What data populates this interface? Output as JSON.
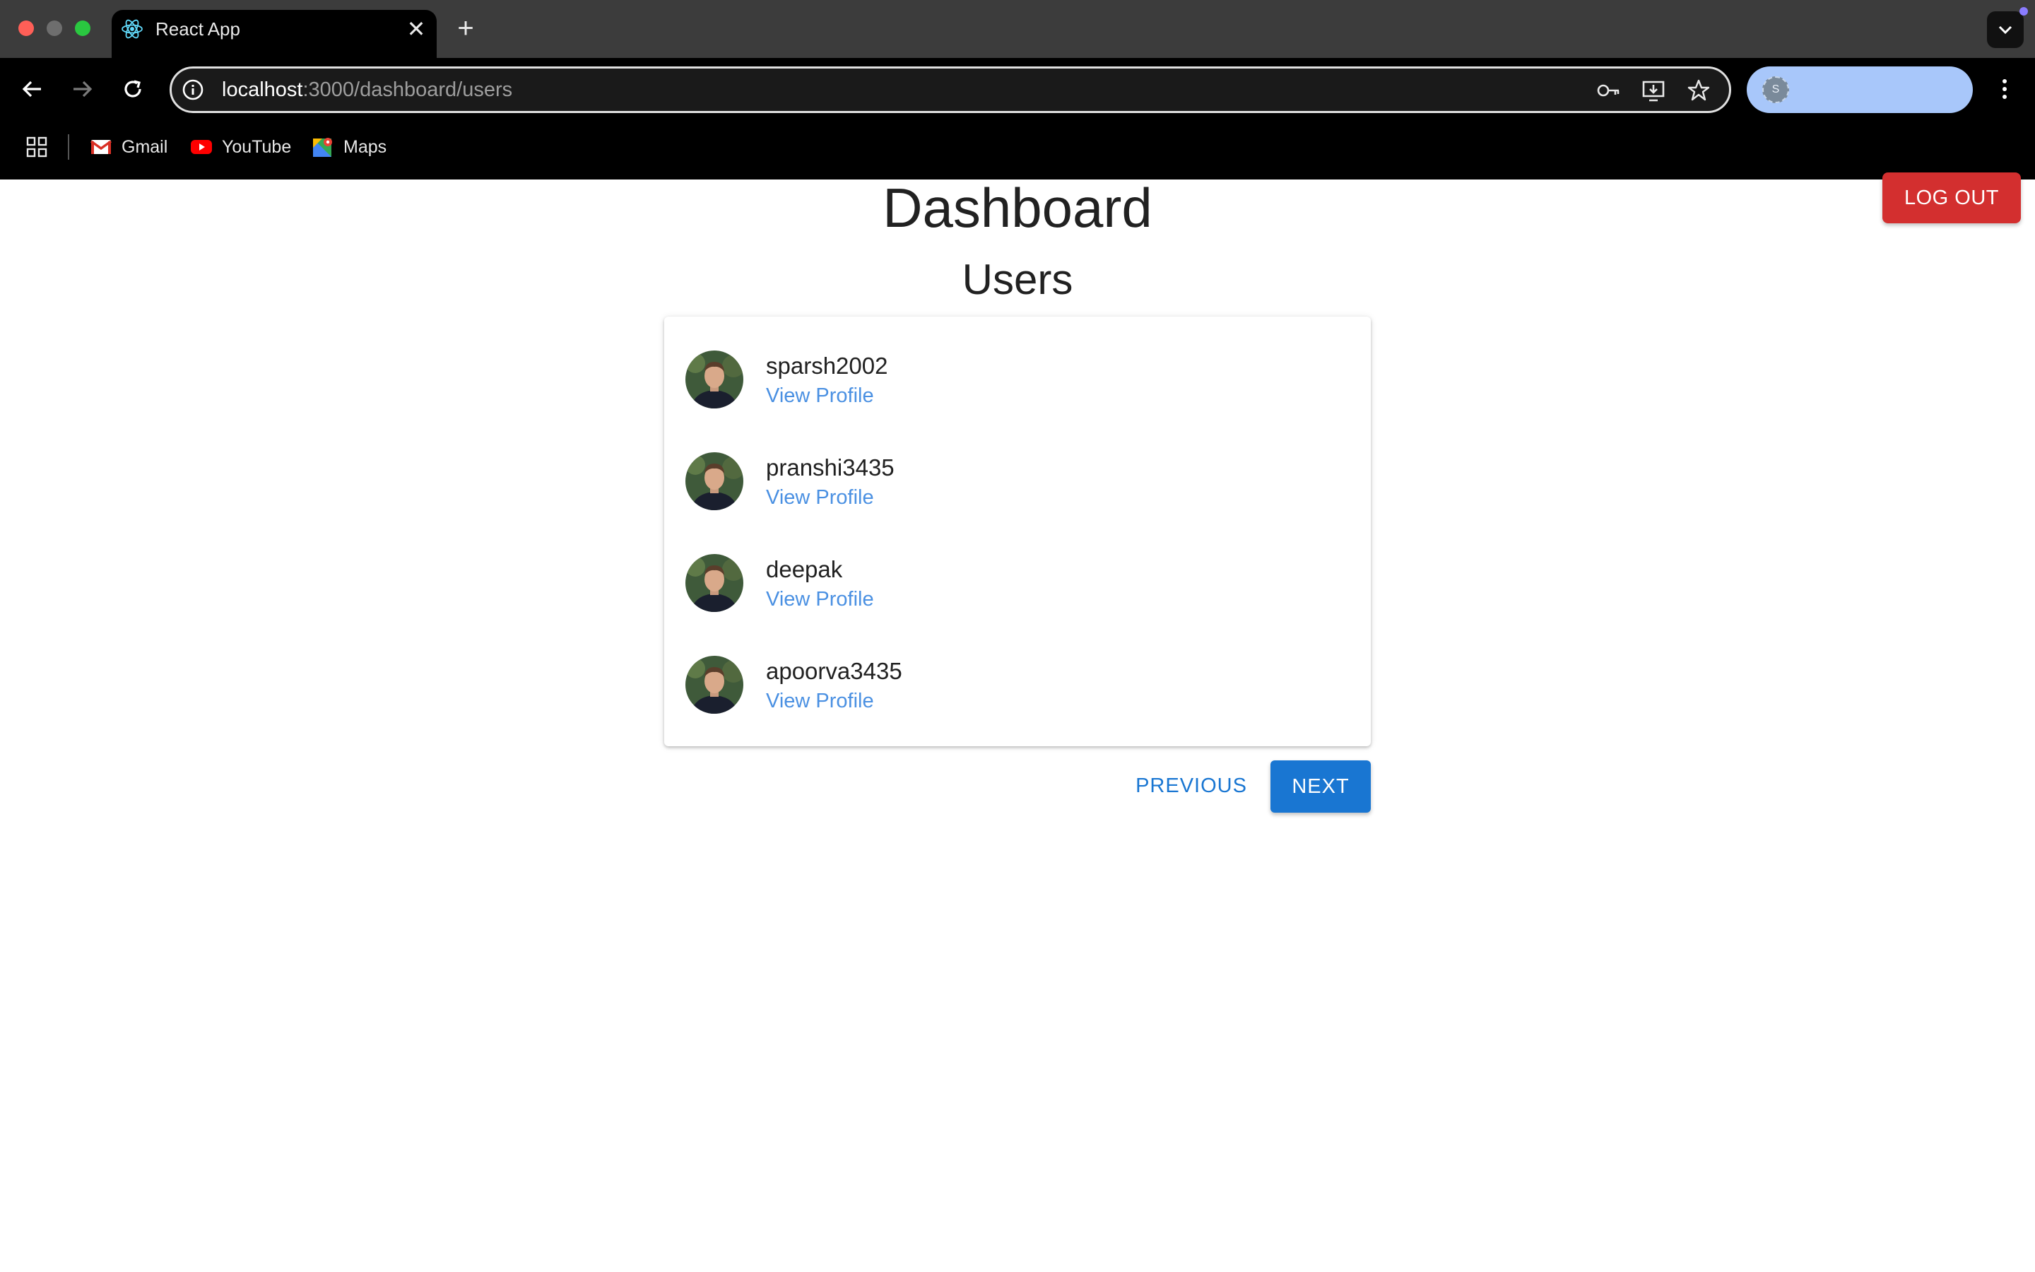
{
  "browser": {
    "tab_title": "React App",
    "url_host": "localhost",
    "url_path": ":3000/dashboard/users",
    "profile_initial": "S",
    "bookmarks": [
      {
        "label": "Gmail",
        "icon": "gmail-icon"
      },
      {
        "label": "YouTube",
        "icon": "youtube-icon"
      },
      {
        "label": "Maps",
        "icon": "maps-icon"
      }
    ]
  },
  "page": {
    "title": "Dashboard",
    "section_title": "Users",
    "logout_label": "LOG OUT"
  },
  "users": [
    {
      "username": "sparsh2002",
      "link_label": "View Profile"
    },
    {
      "username": "pranshi3435",
      "link_label": "View Profile"
    },
    {
      "username": "deepak",
      "link_label": "View Profile"
    },
    {
      "username": "apoorva3435",
      "link_label": "View Profile"
    }
  ],
  "pagination": {
    "previous_label": "PREVIOUS",
    "next_label": "NEXT"
  },
  "colors": {
    "logout": "#d32f2f",
    "primary": "#1976d2",
    "link": "#4a90e2"
  }
}
